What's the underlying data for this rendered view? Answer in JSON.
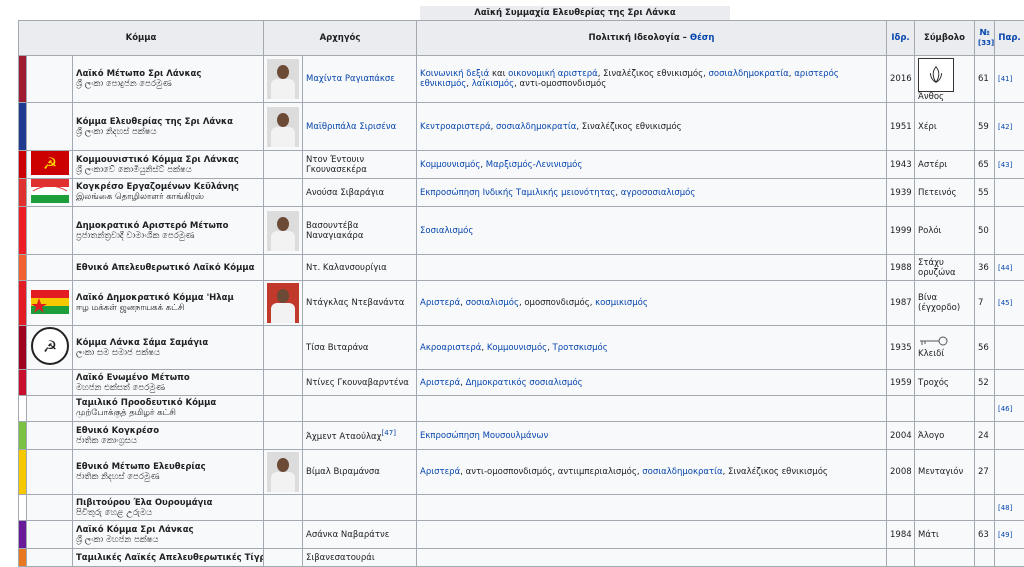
{
  "caption": "Λαϊκή Συμμαχία Ελευθερίας της Σρι Λάνκα",
  "headers": {
    "party": "Κόμμα",
    "leader": "Αρχηγός",
    "ideology": "Πολιτική Ιδεολογία – ",
    "ideology_link": "Θέση",
    "founded": "Ιδρ.",
    "symbol": "Σύμβολο",
    "number": "№",
    "number_ref": "[33]",
    "ref": "Παρ."
  },
  "rows": [
    {
      "color": "#9e1b32",
      "name": "Λαϊκό Μέτωπο Σρι Λάνκας",
      "native": "ශ්‍රී ලංකා පොදුජන පෙරමුණ",
      "leader": "Μαχίντα Ραγιαπάκσε",
      "leader_is_link": true,
      "ideology": "Κοινωνική δεξιά και οικονομική αριστερά, Σιναλέζικος εθνικισμός, σοσιαλδημοκρατία, αριστερός εθνικισμός, λαϊκισμός, αντι-ομοσπονδισμός",
      "founded": "2016",
      "symbol": "Άνθος",
      "number": "61",
      "ref": "[41]"
    },
    {
      "color": "#1f3b8f",
      "name": "Κόμμα Ελευθερίας της Σρι Λάνκα",
      "native": "ශ්‍රී ලංකා නිදහස් පක්ෂය",
      "leader": "Μαϊθριπάλα Σιρισένα",
      "leader_is_link": true,
      "ideology": "Κεντροαριστερά, σοσιαλδημοκρατία, Σιναλέζικος εθνικισμός",
      "founded": "1951",
      "symbol": "Χέρι",
      "number": "59",
      "ref": "[42]"
    },
    {
      "color": "#cc0000",
      "name": "Κομμουνιστικό Κόμμα Σρι Λάνκας",
      "native": "ශ්‍රී ලංකාවේ කොමියුනිස්ට් පක්ෂය",
      "leader": "Ντον Έντουιν Γκουνασεκέρα",
      "leader_is_link": false,
      "ideology": "Κομμουνισμός, Μαρξισμός-Λενινισμός",
      "founded": "1943",
      "symbol": "Αστέρι",
      "number": "65",
      "ref": "[43]"
    },
    {
      "color": "#e03030",
      "name": "Κογκρέσο Εργαζομένων Κεϋλάνης",
      "native": "இலங்கை தொழிலாளர் காங்கிரஸ்",
      "leader": "Ανούσα Σιβαράγια",
      "leader_is_link": false,
      "ideology": "Εκπροσώπηση Ινδικής Ταμιλικής μειονότητας, αγροσοσιαλισμός",
      "founded": "1939",
      "symbol": "Πετεινός",
      "number": "55",
      "ref": ""
    },
    {
      "color": "#ee1c24",
      "name": "Δημοκρατικό Αριστερό Μέτωπο",
      "native": "ප්‍රජාතන්ත්‍රවාදී වාමාංශික පෙරමුණ",
      "leader": "Βασουντέβα Ναναγιακάρα",
      "leader_is_link": false,
      "ideology": "Σοσιαλισμός",
      "founded": "1999",
      "symbol": "Ρολόι",
      "number": "50",
      "ref": ""
    },
    {
      "color": "#f06030",
      "name": "Εθνικό Απελευθερωτικό Λαϊκό Κόμμα",
      "native": "",
      "leader": "Ντ. Καλανσουρίγια",
      "leader_is_link": false,
      "ideology": "",
      "founded": "1988",
      "symbol": "Στάχυ ορυζώνα",
      "number": "36",
      "ref": "[44]"
    },
    {
      "color": "#e31b23",
      "name": "Λαϊκό Δημοκρατικό Κόμμα 'Ηλαμ",
      "native": "ஈழ மக்கள் ஜனநாயகக் கட்சி",
      "leader": "Ντάγκλας Ντεβανάντα",
      "leader_is_link": false,
      "ideology": "Αριστερά, σοσιαλισμός, ομοσπονδισμός, κοσμικισμός",
      "founded": "1987",
      "symbol": "Βίνα (έγχορδο)",
      "number": "7",
      "ref": "[45]"
    },
    {
      "color": "#a0001e",
      "name": "Κόμμα Λάνκα Σάμα Σαμάγια",
      "native": "ලංකා සම සමාජ පක්ෂය",
      "leader": "Τίσα Βιταράνα",
      "leader_is_link": false,
      "ideology": "Ακροαριστερά, Κομμουνισμός, Τροτσκισμός",
      "founded": "1935",
      "symbol": "Κλειδί",
      "number": "56",
      "ref": ""
    },
    {
      "color": "#c8102e",
      "name": "Λαϊκό Ενωμένο Μέτωπο",
      "native": "මහජන එක්සත් පෙරමුණ",
      "leader": "Ντίνες Γκουναβαρντένα",
      "leader_is_link": false,
      "ideology": "Αριστερά, Δημοκρατικός σοσιαλισμός",
      "founded": "1959",
      "symbol": "Τροχός",
      "number": "52",
      "ref": ""
    },
    {
      "color": "#ffffff",
      "name": "Ταμιλικό Προοδευτικό Κόμμα",
      "native": "முற்போக்குத் தமிழர் கட்சி",
      "leader": "",
      "leader_is_link": false,
      "ideology": "",
      "founded": "",
      "symbol": "",
      "number": "",
      "ref": "[46]"
    },
    {
      "color": "#7cc242",
      "name": "Εθνικό Κογκρέσο",
      "native": "ජාතික කොංග්‍රසය",
      "leader": "Άχμεντ Αταούλαχ",
      "leader_ref": "[47]",
      "leader_is_link": false,
      "ideology": "Εκπροσώπηση Μουσουλμάνων",
      "founded": "2004",
      "symbol": "Άλογο",
      "number": "24",
      "ref": ""
    },
    {
      "color": "#f6c800",
      "name": "Εθνικό Μέτωπο Ελευθερίας",
      "native": "ජාතික නිදහස් පෙරමුණ",
      "leader": "Βίμαλ Βιραμάνσα",
      "leader_is_link": false,
      "ideology": "Αριστερά, αντι-ομοσπονδισμός, αντιιμπεριαλισμός, σοσιαλδημοκρατία, Σιναλέζικος εθνικισμός",
      "founded": "2008",
      "symbol": "Μενταγιόν",
      "number": "27",
      "ref": ""
    },
    {
      "color": "#ffffff",
      "name": "Πιβιτούρου Έλα Ουρουμάγια",
      "native": "පිවිතුරු හෙළ උරුමය",
      "leader": "",
      "leader_is_link": false,
      "ideology": "",
      "founded": "",
      "symbol": "",
      "number": "",
      "ref": "[48]"
    },
    {
      "color": "#6a1b9a",
      "name": "Λαϊκό Κόμμα Σρι Λάνκας",
      "native": "ශ්‍රී ලංකා මහජන පක්ෂය",
      "leader": "Ασάνκα Ναβαράτνε",
      "leader_is_link": false,
      "ideology": "",
      "founded": "1984",
      "symbol": "Μάτι",
      "number": "63",
      "ref": "[49]"
    },
    {
      "color": "#e87722",
      "name": "Ταμιλικές Λαϊκές Απελευθερωτικές Τίγρεις",
      "native": "",
      "leader": "Σιβανεσατουράι",
      "leader_is_link": false,
      "ideology": "",
      "founded": "",
      "symbol": "",
      "number": "",
      "ref": ""
    }
  ]
}
